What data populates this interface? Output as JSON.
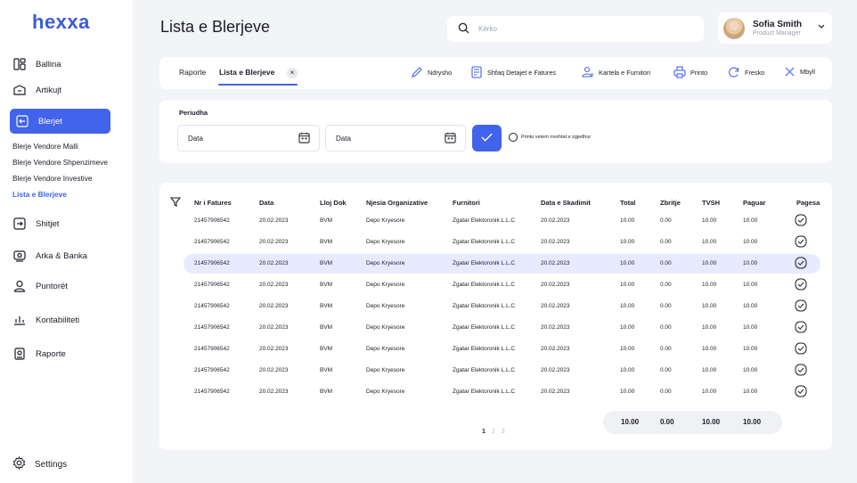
{
  "app": {
    "logo": "hexxa"
  },
  "sidebar": {
    "items": [
      {
        "label": "Ballina",
        "icon": "dashboard-icon"
      },
      {
        "label": "Artikujt",
        "icon": "package-icon"
      },
      {
        "label": "Blerjet",
        "icon": "purchase-icon",
        "active": true
      },
      {
        "label": "Shitjet",
        "icon": "sales-icon"
      },
      {
        "label": "Arka & Banka",
        "icon": "bank-icon"
      },
      {
        "label": "Puntorët",
        "icon": "users-icon"
      },
      {
        "label": "Kontabiliteti",
        "icon": "accounting-icon"
      },
      {
        "label": "Raporte",
        "icon": "report-icon"
      }
    ],
    "subitems": [
      {
        "label": "Blerje Vendore Malli"
      },
      {
        "label": "Blerje Vendore Shpenzimeve"
      },
      {
        "label": "Blerje Vendore Investive"
      },
      {
        "label": "Lista e Blerjeve",
        "active": true
      }
    ],
    "settings_label": "Settings"
  },
  "header": {
    "title": "Lista e Blerjeve",
    "search_placeholder": "Kërko",
    "user_name": "Sofia Smith",
    "user_role": "Product Manager"
  },
  "toolbar": {
    "tabs": [
      {
        "label": "Raporte"
      },
      {
        "label": "Lista e Blerjeve",
        "active": true
      }
    ],
    "close_glyph": "×",
    "actions": [
      {
        "label": "Ndrysho",
        "icon": "pencil-icon"
      },
      {
        "label": "Shfaq Detajet e Fatures",
        "icon": "invoice-details-icon"
      },
      {
        "label": "Kartela e Furnitori",
        "icon": "supplier-card-icon"
      },
      {
        "label": "Printo",
        "icon": "printer-icon"
      },
      {
        "label": "Fresko",
        "icon": "refresh-icon"
      },
      {
        "label": "Mbyll",
        "icon": "close-icon"
      }
    ]
  },
  "filter": {
    "label": "Periudha",
    "date_from": "Data",
    "date_to": "Data",
    "checkbox_label": "Printo vetem rreshtat e zgjedhur"
  },
  "table": {
    "columns": [
      "Nr i Fatures",
      "Data",
      "Lloj Dok",
      "Njesia Organizative",
      "Furnitori",
      "Data e Skadimit",
      "Total",
      "Zbritje",
      "TVSH",
      "Paguar",
      "Pagesa"
    ],
    "rows": [
      [
        "21457906542",
        "20.02.2023",
        "BVM",
        "Depo Kryesore",
        "Zgatar Elektoronik L.L.C",
        "20.02.2023",
        "10.00",
        "0.00",
        "10.00",
        "10.00"
      ],
      [
        "21457906542",
        "20.02.2023",
        "BVM",
        "Depo Kryesore",
        "Zgatar Elektoronik L.L.C",
        "20.02.2023",
        "10.00",
        "0.00",
        "10.00",
        "10.00"
      ],
      [
        "21457906542",
        "20.02.2023",
        "BVM",
        "Depo Kryesore",
        "Zgatar Elektoronik L.L.C",
        "20.02.2023",
        "10.00",
        "0.00",
        "10.00",
        "10.00"
      ],
      [
        "21457906542",
        "20.02.2023",
        "BVM",
        "Depo Kryesore",
        "Zgatar Elektoronik L.L.C",
        "20.02.2023",
        "10.00",
        "0.00",
        "10.00",
        "10.00"
      ],
      [
        "21457906542",
        "20.02.2023",
        "BVM",
        "Depo Kryesore",
        "Zgatar Elektoronik L.L.C",
        "20.02.2023",
        "10.00",
        "0.00",
        "10.00",
        "10.00"
      ],
      [
        "21457906542",
        "20.02.2023",
        "BVM",
        "Depo Kryesore",
        "Zgatar Elektoronik L.L.C",
        "20.02.2023",
        "10.00",
        "0.00",
        "10.00",
        "10.00"
      ],
      [
        "21457906542",
        "20.02.2023",
        "BVM",
        "Depo Kryesore",
        "Zgatar Elektoronik L.L.C",
        "20.02.2023",
        "10.00",
        "0.00",
        "10.00",
        "10.00"
      ],
      [
        "21457906542",
        "20.02.2023",
        "BVM",
        "Depo Kryesore",
        "Zgatar Elektoronik L.L.C",
        "20.02.2023",
        "10.00",
        "0.00",
        "10.00",
        "10.00"
      ],
      [
        "21457906542",
        "20.02.2023",
        "BVM",
        "Depo Kryesore",
        "Zgatar Elektoronik L.L.C",
        "20.02.2023",
        "10.00",
        "0.00",
        "10.00",
        "10.00"
      ]
    ],
    "selected_row": 2,
    "totals": [
      "10.00",
      "0.00",
      "10.00",
      "10.00"
    ],
    "pages": [
      "1",
      "2",
      "3"
    ],
    "current_page": "1"
  },
  "colors": {
    "accent": "#4263eb",
    "selected_row": "#e6ebff",
    "background": "#f3f4f7"
  }
}
